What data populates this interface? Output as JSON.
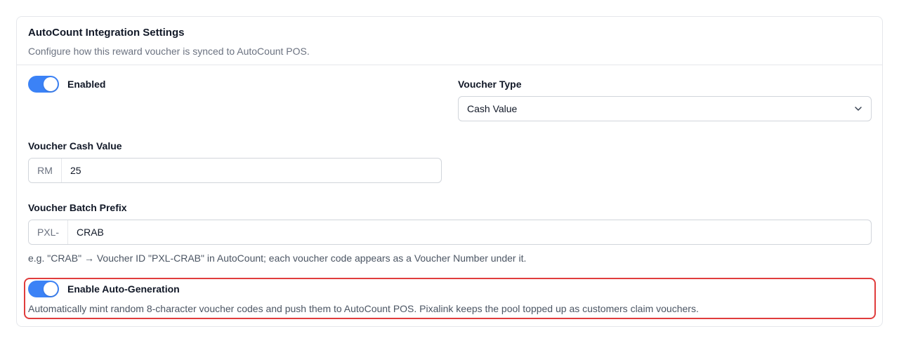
{
  "card": {
    "title": "AutoCount Integration Settings",
    "description": "Configure how this reward voucher is synced to AutoCount POS."
  },
  "enabled_toggle": {
    "label": "Enabled",
    "on": true
  },
  "voucher_type": {
    "label": "Voucher Type",
    "selected": "Cash Value"
  },
  "cash_value": {
    "label": "Voucher Cash Value",
    "prefix": "RM",
    "value": "25"
  },
  "batch_prefix": {
    "label": "Voucher Batch Prefix",
    "prefix": "PXL-",
    "value": "CRAB",
    "help": "e.g. \"CRAB\" → Voucher ID \"PXL-CRAB\" in AutoCount; each voucher code appears as a Voucher Number under it."
  },
  "auto_generation": {
    "label": "Enable Auto-Generation",
    "on": true,
    "description": "Automatically mint random 8-character voucher codes and push them to AutoCount POS. Pixalink keeps the pool topped up as customers claim vouchers."
  },
  "colors": {
    "accent": "#3b82f6",
    "highlight": "#e03c3c"
  },
  "icons": {
    "select_chevron": "chevron-down-icon"
  }
}
